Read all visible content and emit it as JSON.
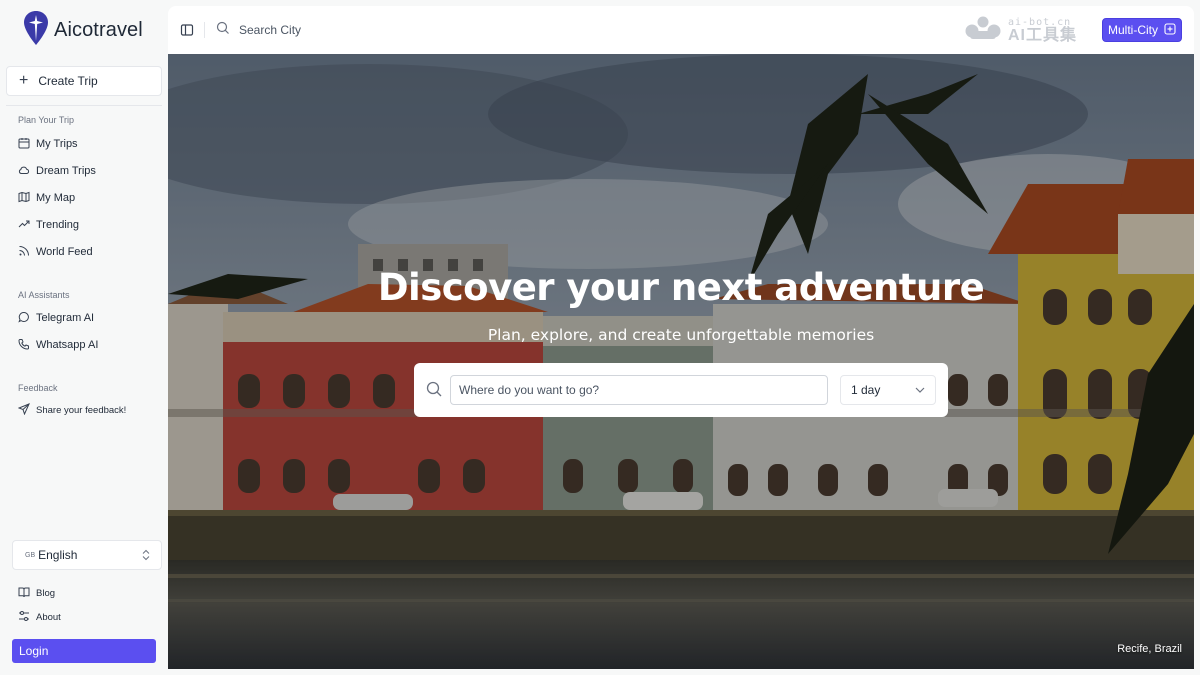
{
  "app": {
    "name": "Aicotravel"
  },
  "sidebar": {
    "create_trip_label": "Create Trip",
    "sections": [
      {
        "title": "Plan Your Trip",
        "items": [
          {
            "label": "My Trips",
            "icon": "calendar-icon"
          },
          {
            "label": "Dream Trips",
            "icon": "cloud-icon"
          },
          {
            "label": "My Map",
            "icon": "map-icon"
          },
          {
            "label": "Trending",
            "icon": "trending-icon"
          },
          {
            "label": "World Feed",
            "icon": "rss-icon"
          }
        ]
      },
      {
        "title": "AI Assistants",
        "items": [
          {
            "label": "Telegram AI",
            "icon": "chat-bubble-icon"
          },
          {
            "label": "Whatsapp AI",
            "icon": "phone-icon"
          }
        ]
      },
      {
        "title": "Feedback",
        "items": [
          {
            "label": "Share your feedback!",
            "icon": "send-icon"
          }
        ]
      }
    ],
    "language": {
      "flag": "GB",
      "label": "English"
    },
    "footer_links": [
      {
        "label": "Blog",
        "icon": "book-icon"
      },
      {
        "label": "About",
        "icon": "settings-icon"
      }
    ],
    "login_label": "Login"
  },
  "topbar": {
    "search_placeholder": "Search City",
    "watermark": {
      "url": "ai-bot.cn",
      "name": "AI工具集"
    },
    "multi_city_label": "Multi-City"
  },
  "hero": {
    "title": "Discover your next adventure",
    "subtitle": "Plan, explore, and create unforgettable memories",
    "search_placeholder": "Where do you want to go?",
    "duration_value": "1 day",
    "location_caption": "Recife, Brazil"
  },
  "colors": {
    "accent": "#5b4ff0",
    "logo": "#3b3aa8"
  }
}
